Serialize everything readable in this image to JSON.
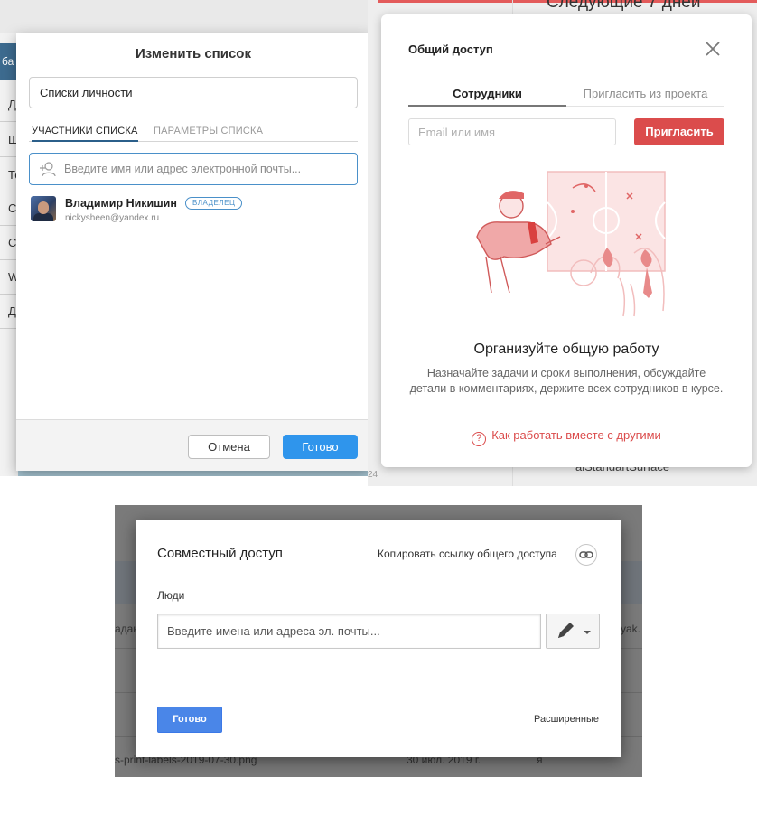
{
  "panel1": {
    "sidebar_rows": [
      "Д",
      "Ш",
      "Те",
      "С",
      "С",
      "W",
      "Д"
    ],
    "sidebar_top": "ба",
    "title": "Изменить список",
    "list_name_value": "Списки личности",
    "tabs": [
      "УЧАСТНИКИ СПИСКА",
      "ПАРАМЕТРЫ СПИСКА"
    ],
    "search_placeholder": "Введите имя или адрес электронной почты...",
    "member": {
      "name": "Владимир Никишин",
      "badge": "ВЛАДЕЛЕЦ",
      "email": "nickysheen@yandex.ru"
    },
    "cancel_label": "Отмена",
    "done_label": "Готово",
    "accent_color": "#2f95ec"
  },
  "panel2": {
    "bg_title": "Следующие 7 дней",
    "bg_bottom_text": "aiStandartSurface",
    "bg_left_text": "24",
    "title": "Общий доступ",
    "tabs": [
      "Сотрудники",
      "Пригласить из проекта"
    ],
    "input_placeholder": "Email или имя",
    "invite_label": "Пригласить",
    "heading": "Организуйте общую работу",
    "description": "Назначайте задачи и сроки выполнения, обсуждайте детали в комментариях, держите всех сотрудников в курсе.",
    "help_link": "Как работать вместе с другими",
    "accent_color": "#db4c4c"
  },
  "panel3": {
    "bg_left_text": "адак",
    "bg_right_text": "yak.",
    "bg_file": "s-print-labels-2019-07-30.png",
    "bg_date": "30 июл. 2019 г.",
    "bg_owner": "я",
    "title": "Совместный доступ",
    "copy_link_label": "Копировать ссылку общего доступа",
    "people_label": "Люди",
    "input_placeholder": "Введите имена или адреса эл. почты...",
    "done_label": "Готово",
    "advanced_label": "Расширенные",
    "accent_color": "#4a86e8"
  }
}
